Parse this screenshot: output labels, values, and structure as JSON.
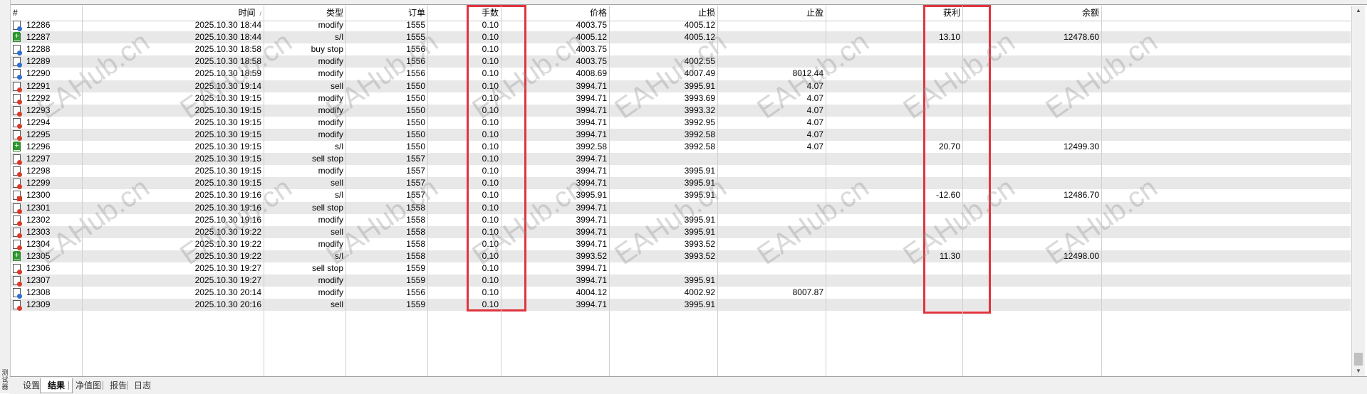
{
  "columns": {
    "id": "#",
    "time": "时间",
    "type": "类型",
    "order": "订单",
    "lots": "手数",
    "price": "价格",
    "sl": "止损",
    "tp": "止盈",
    "profit": "获利",
    "balance": "余额"
  },
  "sort_indicator": "/",
  "rows": [
    {
      "id": "12286",
      "time": "2025.10.30 18:44",
      "type": "modify",
      "order": "1555",
      "lots": "0.10",
      "price": "4003.75",
      "sl": "4005.12",
      "tp": "",
      "profit": "",
      "balance": "",
      "icon": "modify-ticket-icon",
      "dot": "blue"
    },
    {
      "id": "12287",
      "time": "2025.10.30 18:44",
      "type": "s/l",
      "order": "1555",
      "lots": "0.10",
      "price": "4005.12",
      "sl": "4005.12",
      "tp": "",
      "profit": "13.10",
      "balance": "12478.60",
      "icon": "profit-ticket-icon",
      "dot": "green"
    },
    {
      "id": "12288",
      "time": "2025.10.30 18:58",
      "type": "buy stop",
      "order": "1556",
      "lots": "0.10",
      "price": "4003.75",
      "sl": "",
      "tp": "",
      "profit": "",
      "balance": "",
      "icon": "pending-ticket-icon",
      "dot": "blue"
    },
    {
      "id": "12289",
      "time": "2025.10.30 18:58",
      "type": "modify",
      "order": "1556",
      "lots": "0.10",
      "price": "4003.75",
      "sl": "4002.55",
      "tp": "",
      "profit": "",
      "balance": "",
      "icon": "modify-ticket-icon",
      "dot": "blue"
    },
    {
      "id": "12290",
      "time": "2025.10.30 18:59",
      "type": "modify",
      "order": "1556",
      "lots": "0.10",
      "price": "4008.69",
      "sl": "4007.49",
      "tp": "8012.44",
      "profit": "",
      "balance": "",
      "icon": "modify-ticket-icon",
      "dot": "blue"
    },
    {
      "id": "12291",
      "time": "2025.10.30 19:14",
      "type": "sell",
      "order": "1550",
      "lots": "0.10",
      "price": "3994.71",
      "sl": "3995.91",
      "tp": "4.07",
      "profit": "",
      "balance": "",
      "icon": "sell-ticket-icon",
      "dot": "red"
    },
    {
      "id": "12292",
      "time": "2025.10.30 19:15",
      "type": "modify",
      "order": "1550",
      "lots": "0.10",
      "price": "3994.71",
      "sl": "3993.69",
      "tp": "4.07",
      "profit": "",
      "balance": "",
      "icon": "modify-ticket-icon",
      "dot": "red"
    },
    {
      "id": "12293",
      "time": "2025.10.30 19:15",
      "type": "modify",
      "order": "1550",
      "lots": "0.10",
      "price": "3994.71",
      "sl": "3993.32",
      "tp": "4.07",
      "profit": "",
      "balance": "",
      "icon": "modify-ticket-icon",
      "dot": "red"
    },
    {
      "id": "12294",
      "time": "2025.10.30 19:15",
      "type": "modify",
      "order": "1550",
      "lots": "0.10",
      "price": "3994.71",
      "sl": "3992.95",
      "tp": "4.07",
      "profit": "",
      "balance": "",
      "icon": "modify-ticket-icon",
      "dot": "red"
    },
    {
      "id": "12295",
      "time": "2025.10.30 19:15",
      "type": "modify",
      "order": "1550",
      "lots": "0.10",
      "price": "3994.71",
      "sl": "3992.58",
      "tp": "4.07",
      "profit": "",
      "balance": "",
      "icon": "modify-ticket-icon",
      "dot": "red"
    },
    {
      "id": "12296",
      "time": "2025.10.30 19:15",
      "type": "s/l",
      "order": "1550",
      "lots": "0.10",
      "price": "3992.58",
      "sl": "3992.58",
      "tp": "4.07",
      "profit": "20.70",
      "balance": "12499.30",
      "icon": "profit-ticket-icon",
      "dot": "green"
    },
    {
      "id": "12297",
      "time": "2025.10.30 19:15",
      "type": "sell stop",
      "order": "1557",
      "lots": "0.10",
      "price": "3994.71",
      "sl": "",
      "tp": "",
      "profit": "",
      "balance": "",
      "icon": "pending-ticket-icon",
      "dot": "red"
    },
    {
      "id": "12298",
      "time": "2025.10.30 19:15",
      "type": "modify",
      "order": "1557",
      "lots": "0.10",
      "price": "3994.71",
      "sl": "3995.91",
      "tp": "",
      "profit": "",
      "balance": "",
      "icon": "modify-ticket-icon",
      "dot": "red"
    },
    {
      "id": "12299",
      "time": "2025.10.30 19:15",
      "type": "sell",
      "order": "1557",
      "lots": "0.10",
      "price": "3994.71",
      "sl": "3995.91",
      "tp": "",
      "profit": "",
      "balance": "",
      "icon": "sell-ticket-icon",
      "dot": "red"
    },
    {
      "id": "12300",
      "time": "2025.10.30 19:16",
      "type": "s/l",
      "order": "1557",
      "lots": "0.10",
      "price": "3995.91",
      "sl": "3995.91",
      "tp": "",
      "profit": "-12.60",
      "balance": "12486.70",
      "icon": "loss-ticket-icon",
      "dot": "redsq"
    },
    {
      "id": "12301",
      "time": "2025.10.30 19:16",
      "type": "sell stop",
      "order": "1558",
      "lots": "0.10",
      "price": "3994.71",
      "sl": "",
      "tp": "",
      "profit": "",
      "balance": "",
      "icon": "pending-ticket-icon",
      "dot": "red"
    },
    {
      "id": "12302",
      "time": "2025.10.30 19:16",
      "type": "modify",
      "order": "1558",
      "lots": "0.10",
      "price": "3994.71",
      "sl": "3995.91",
      "tp": "",
      "profit": "",
      "balance": "",
      "icon": "modify-ticket-icon",
      "dot": "red"
    },
    {
      "id": "12303",
      "time": "2025.10.30 19:22",
      "type": "sell",
      "order": "1558",
      "lots": "0.10",
      "price": "3994.71",
      "sl": "3995.91",
      "tp": "",
      "profit": "",
      "balance": "",
      "icon": "sell-ticket-icon",
      "dot": "red"
    },
    {
      "id": "12304",
      "time": "2025.10.30 19:22",
      "type": "modify",
      "order": "1558",
      "lots": "0.10",
      "price": "3994.71",
      "sl": "3993.52",
      "tp": "",
      "profit": "",
      "balance": "",
      "icon": "modify-ticket-icon",
      "dot": "red"
    },
    {
      "id": "12305",
      "time": "2025.10.30 19:22",
      "type": "s/l",
      "order": "1558",
      "lots": "0.10",
      "price": "3993.52",
      "sl": "3993.52",
      "tp": "",
      "profit": "11.30",
      "balance": "12498.00",
      "icon": "profit-ticket-icon",
      "dot": "green"
    },
    {
      "id": "12306",
      "time": "2025.10.30 19:27",
      "type": "sell stop",
      "order": "1559",
      "lots": "0.10",
      "price": "3994.71",
      "sl": "",
      "tp": "",
      "profit": "",
      "balance": "",
      "icon": "pending-ticket-icon",
      "dot": "red"
    },
    {
      "id": "12307",
      "time": "2025.10.30 19:27",
      "type": "modify",
      "order": "1559",
      "lots": "0.10",
      "price": "3994.71",
      "sl": "3995.91",
      "tp": "",
      "profit": "",
      "balance": "",
      "icon": "modify-ticket-icon",
      "dot": "red"
    },
    {
      "id": "12308",
      "time": "2025.10.30 20:14",
      "type": "modify",
      "order": "1556",
      "lots": "0.10",
      "price": "4004.12",
      "sl": "4002.92",
      "tp": "8007.87",
      "profit": "",
      "balance": "",
      "icon": "modify-ticket-icon",
      "dot": "blue"
    },
    {
      "id": "12309",
      "time": "2025.10.30 20:16",
      "type": "sell",
      "order": "1559",
      "lots": "0.10",
      "price": "3994.71",
      "sl": "3995.91",
      "tp": "",
      "profit": "",
      "balance": "",
      "icon": "sell-ticket-icon",
      "dot": "red"
    }
  ],
  "tabs": [
    "设置",
    "结果",
    "净值图",
    "报告",
    "日志"
  ],
  "active_tab": "结果",
  "side_panel_label": "测试器",
  "watermark": "EAHub.cn",
  "colors": {
    "highlight_border": "#e0343e",
    "row_alt": "#e8e8e8",
    "dot_blue": "#2f6fd0",
    "dot_red": "#d83a2a",
    "dot_green": "#2f9a2f"
  }
}
